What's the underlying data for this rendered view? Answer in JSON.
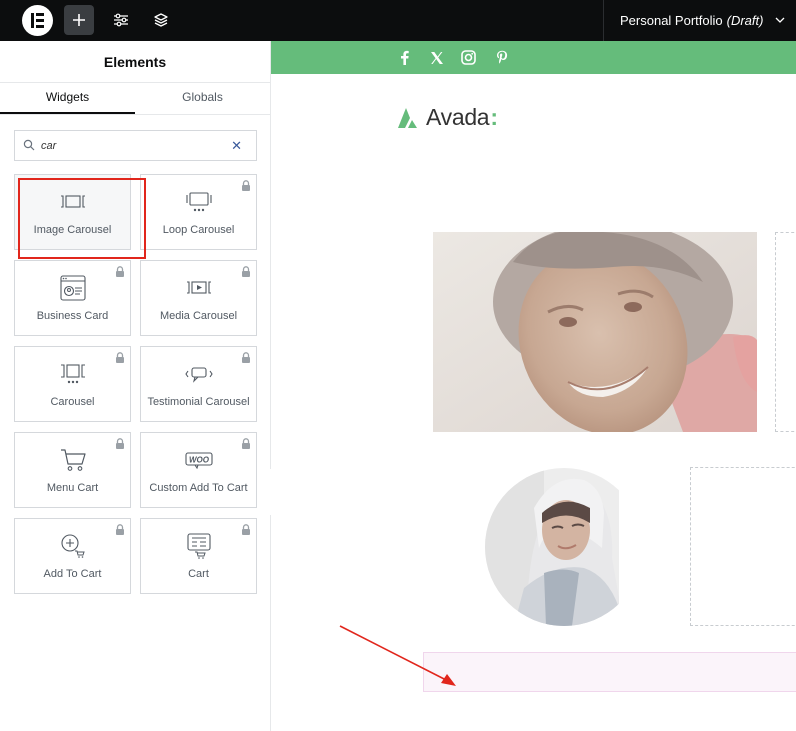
{
  "topbar": {
    "doc_name": "Personal Portfolio",
    "doc_status": "(Draft)",
    "buttons": [
      "add-element",
      "site-settings",
      "structure"
    ]
  },
  "panel": {
    "title": "Elements",
    "tabs": [
      {
        "label": "Widgets",
        "active": true
      },
      {
        "label": "Globals",
        "active": false
      }
    ],
    "search": {
      "value": "car",
      "placeholder": "Search Widget..."
    },
    "widgets": [
      {
        "label": "Image Carousel",
        "icon": "image-carousel-icon",
        "locked": false,
        "highlighted": true
      },
      {
        "label": "Loop Carousel",
        "icon": "loop-carousel-icon",
        "locked": true
      },
      {
        "label": "Business Card",
        "icon": "business-card-icon",
        "locked": true
      },
      {
        "label": "Media Carousel",
        "icon": "media-carousel-icon",
        "locked": true
      },
      {
        "label": "Carousel",
        "icon": "carousel-icon",
        "locked": true
      },
      {
        "label": "Testimonial Carousel",
        "icon": "testimonial-carousel-icon",
        "locked": true
      },
      {
        "label": "Menu Cart",
        "icon": "cart-icon",
        "locked": true
      },
      {
        "label": "Custom Add To Cart",
        "icon": "woo-icon",
        "locked": true
      },
      {
        "label": "Add To Cart",
        "icon": "add-to-cart-icon",
        "locked": true
      },
      {
        "label": "Cart",
        "icon": "cart-register-icon",
        "locked": true
      }
    ]
  },
  "canvas": {
    "social_icons": [
      "facebook-icon",
      "x-icon",
      "instagram-icon",
      "pinterest-icon"
    ],
    "brand": {
      "name": "Avada",
      "suffix": ":"
    },
    "colors": {
      "accent": "#65bc7b",
      "highlight": "#e1261c"
    }
  }
}
